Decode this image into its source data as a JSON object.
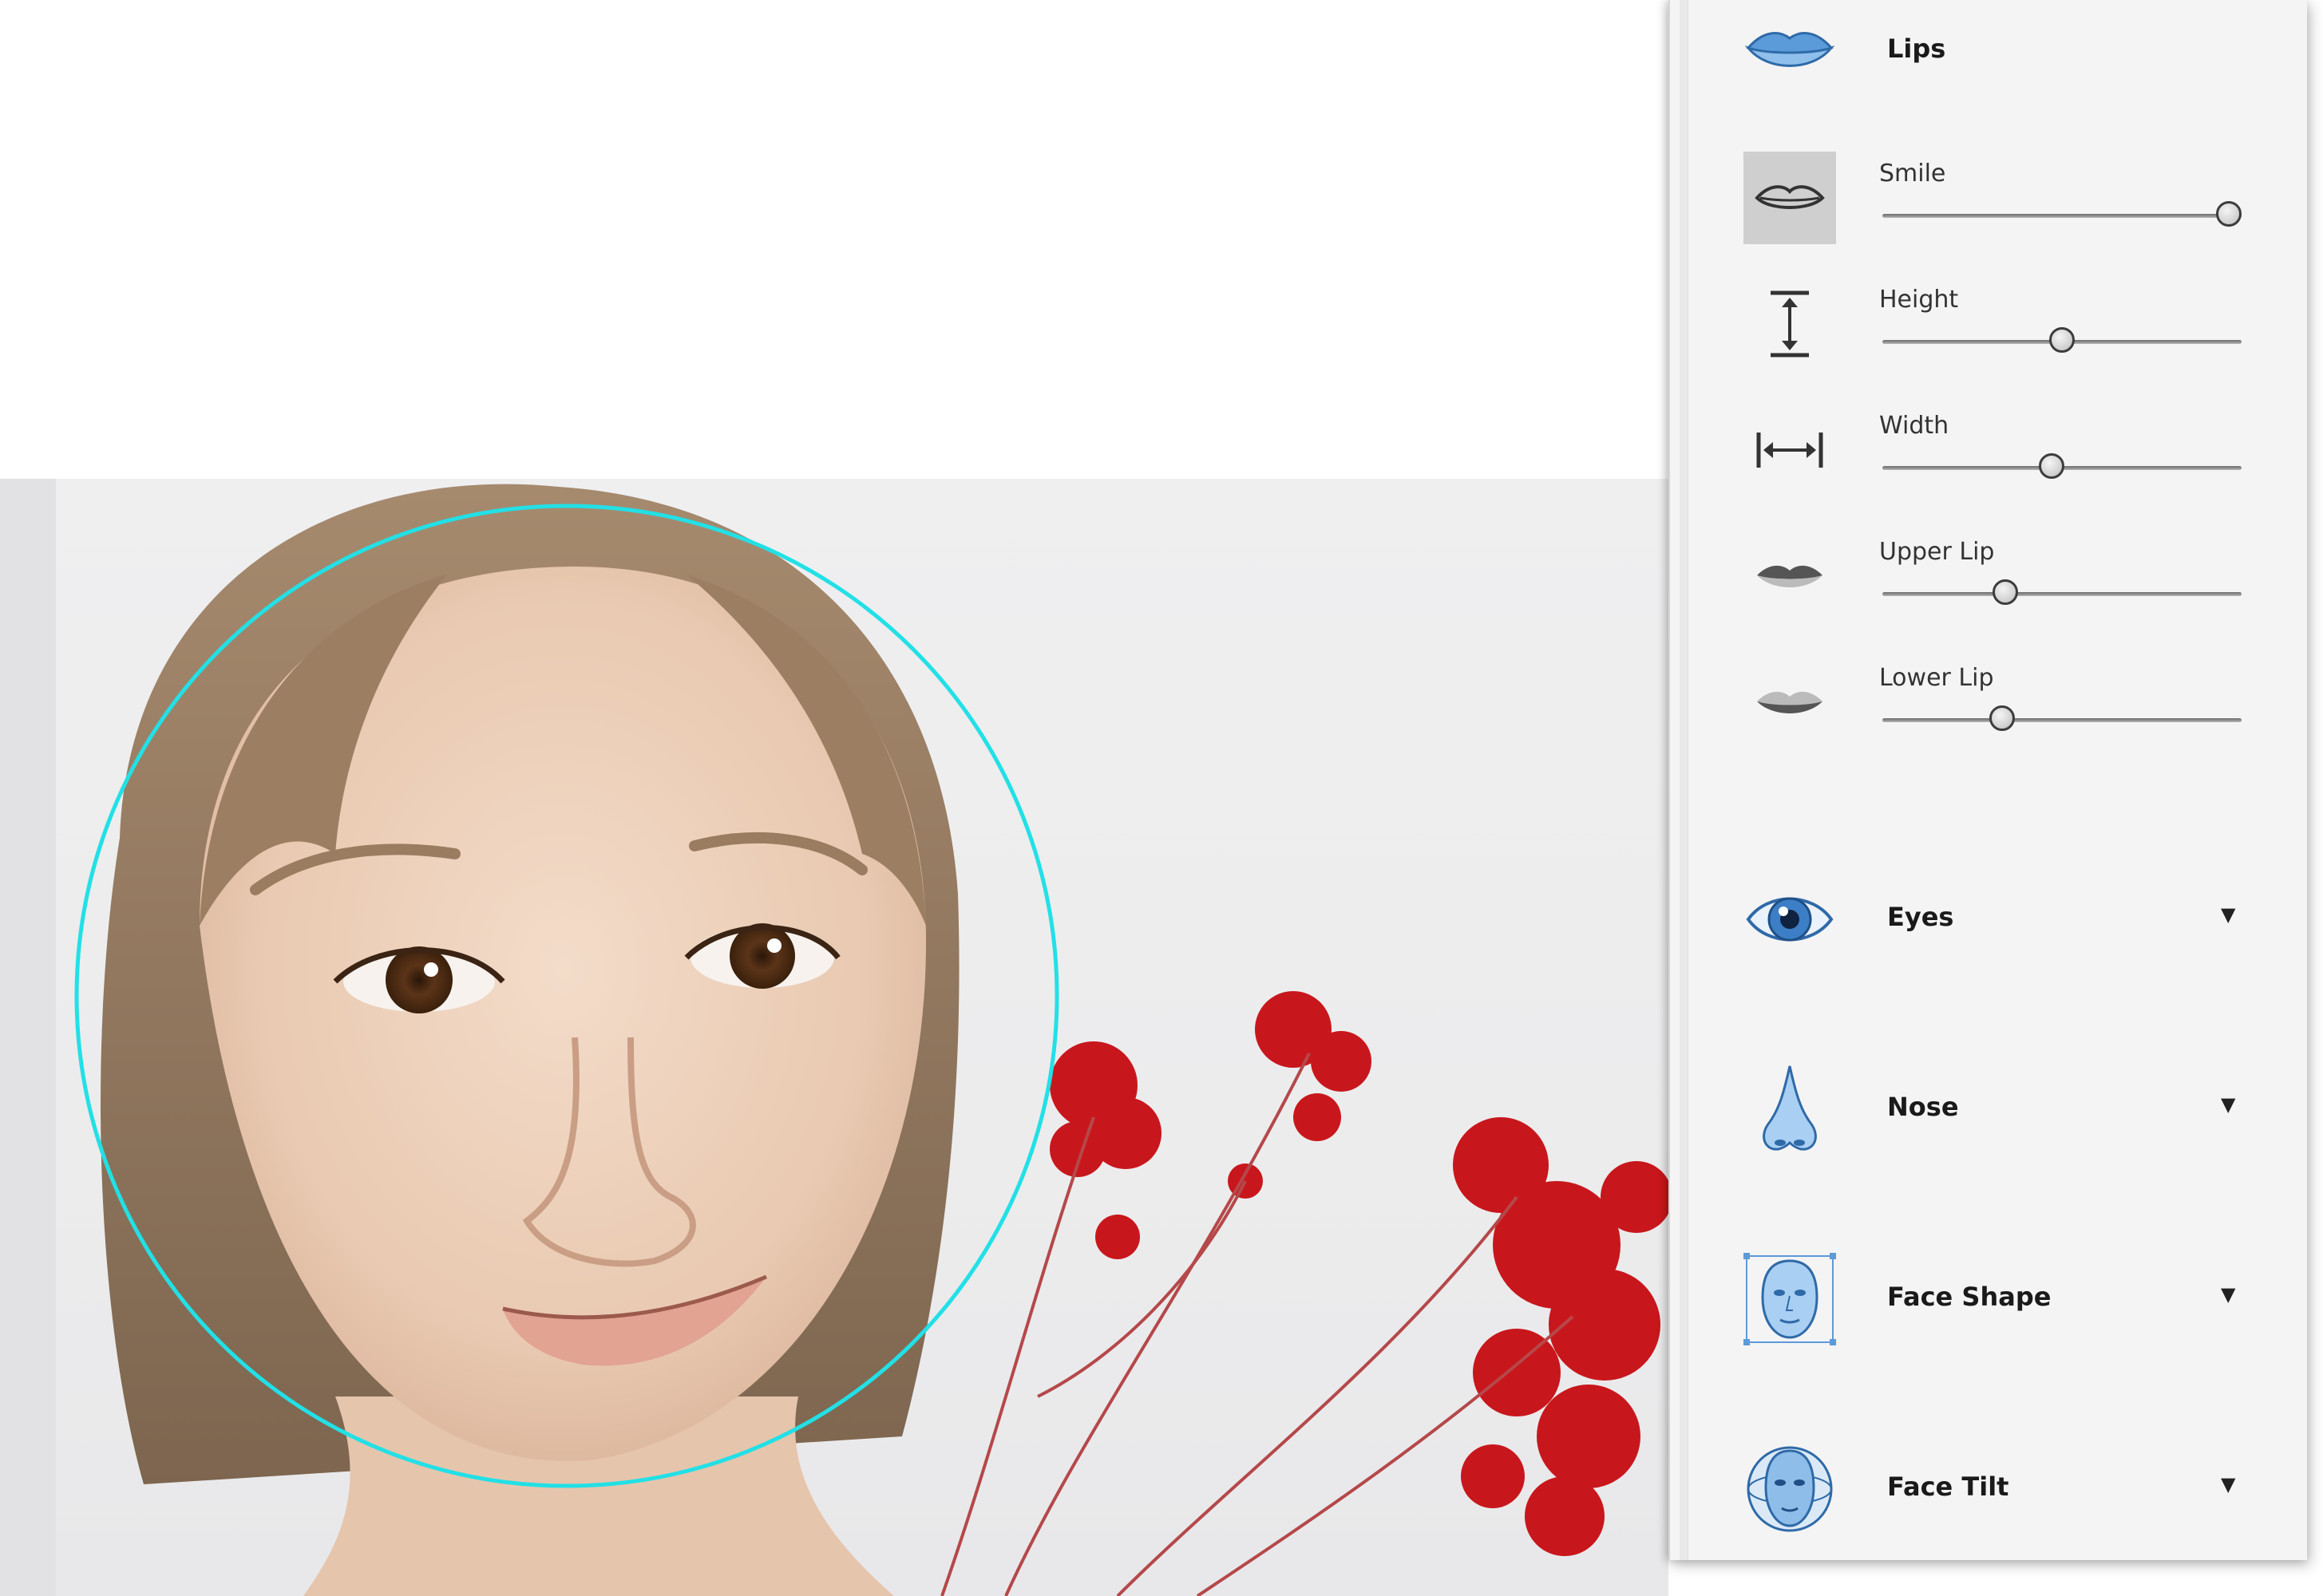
{
  "panel": {
    "lips_section": {
      "title": "Lips",
      "sliders": [
        {
          "label": "Smile",
          "value": 1.0,
          "icon": "smile-lips-icon",
          "selected": true
        },
        {
          "label": "Height",
          "value": 0.5,
          "icon": "height-arrow-icon",
          "selected": false
        },
        {
          "label": "Width",
          "value": 0.47,
          "icon": "width-arrow-icon",
          "selected": false
        },
        {
          "label": "Upper Lip",
          "value": 0.33,
          "icon": "upper-lip-icon",
          "selected": false
        },
        {
          "label": "Lower Lip",
          "value": 0.32,
          "icon": "lower-lip-icon",
          "selected": false
        }
      ]
    },
    "sections": [
      {
        "title": "Eyes",
        "icon": "eye-icon",
        "chevron": "▼"
      },
      {
        "title": "Nose",
        "icon": "nose-icon",
        "chevron": "▼"
      },
      {
        "title": "Face Shape",
        "icon": "face-shape-icon",
        "chevron": "▼"
      },
      {
        "title": "Face Tilt",
        "icon": "face-tilt-icon",
        "chevron": "▼"
      }
    ]
  },
  "colors": {
    "selection_circle": "#22e0e6",
    "panel_bg": "#f4f4f4",
    "icon_blue": "#5b9bd9"
  }
}
